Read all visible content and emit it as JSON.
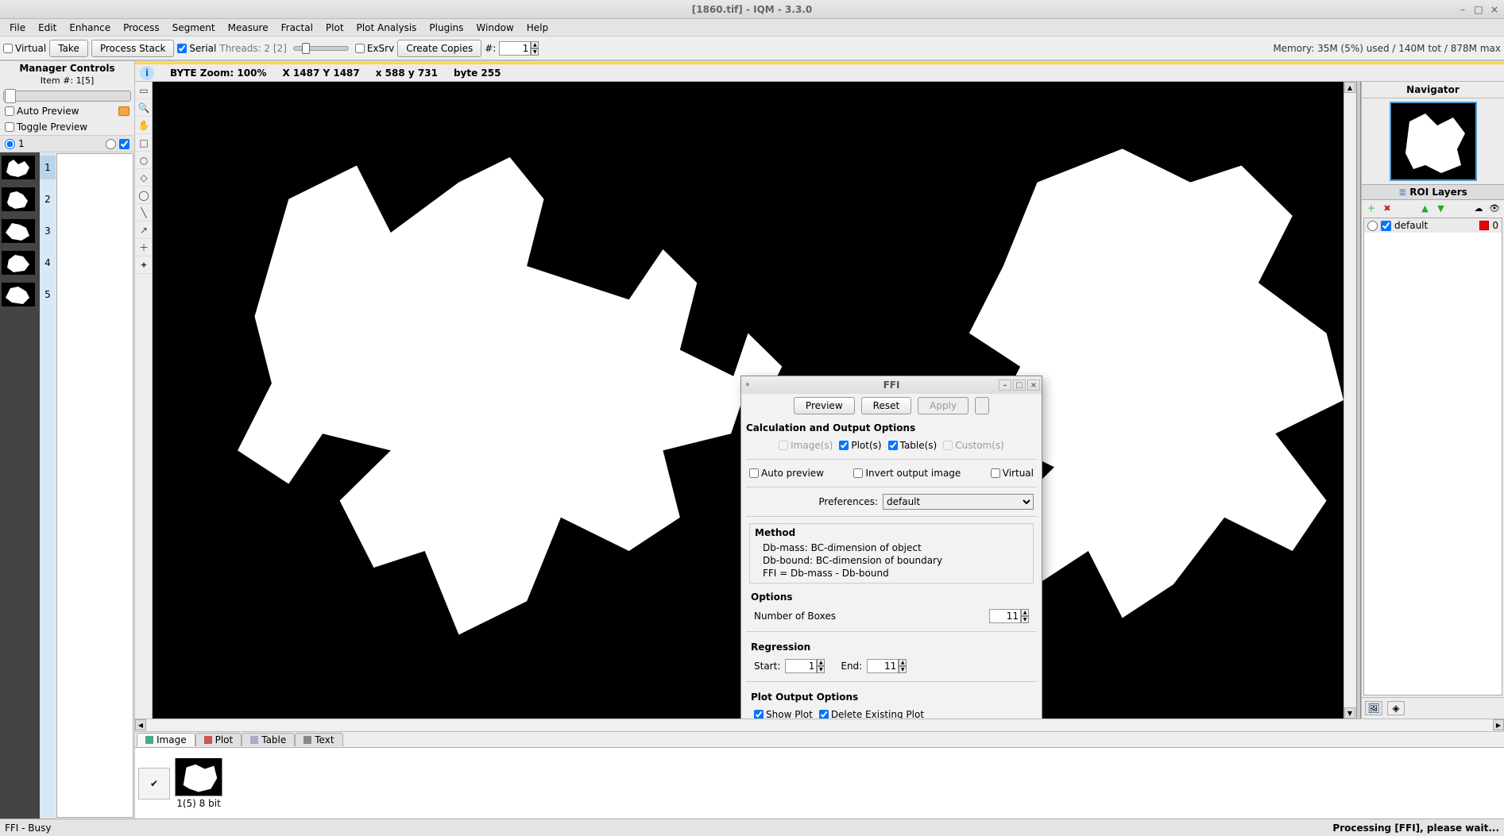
{
  "title": "[1860.tif] - IQM - 3.3.0",
  "window_controls": {
    "min": "–",
    "max": "□",
    "close": "×"
  },
  "menu": [
    "File",
    "Edit",
    "Enhance",
    "Process",
    "Segment",
    "Measure",
    "Fractal",
    "Plot",
    "Plot Analysis",
    "Plugins",
    "Window",
    "Help"
  ],
  "toolbar": {
    "virtual": "Virtual",
    "take": "Take",
    "process_stack": "Process Stack",
    "serial": "Serial",
    "threads": "Threads: 2 [2]",
    "exsrv": "ExSrv",
    "create_copies": "Create Copies",
    "hash_label": "#:",
    "hash_val": "1",
    "memory": "Memory: 35M (5%) used / 140M tot / 878M max"
  },
  "manager": {
    "title": "Manager Controls",
    "item": "Item #: 1[5]",
    "auto_preview": "Auto Preview",
    "toggle_preview": "Toggle Preview",
    "radio_val": "1",
    "thumbs": [
      "1",
      "2",
      "3",
      "4",
      "5"
    ]
  },
  "infobar": {
    "a": "BYTE Zoom: 100%",
    "b": "X 1487  Y 1487",
    "c": "x 588  y 731",
    "d": "byte 255"
  },
  "tools": [
    "▭",
    "🔍",
    "✋",
    "□",
    "○",
    "◇",
    "◯",
    "╲",
    "↗",
    "＋",
    "✦"
  ],
  "navigator": {
    "title": "Navigator"
  },
  "roi": {
    "title": "ROI Layers",
    "row": {
      "name": "default",
      "count": "0"
    }
  },
  "tabs": {
    "image": "Image",
    "plot": "Plot",
    "table": "Table",
    "text": "Text"
  },
  "thumb_label": "1(5) 8 bit",
  "status": {
    "left": "FFI - Busy",
    "right": "Processing [FFI], please wait..."
  },
  "dialog": {
    "title": "FFI",
    "preview": "Preview",
    "reset": "Reset",
    "apply": "Apply",
    "calc_title": "Calculation and Output Options",
    "images": "Image(s)",
    "plots": "Plot(s)",
    "tables": "Table(s)",
    "customs": "Custom(s)",
    "auto_preview": "Auto preview",
    "invert": "Invert output image",
    "virtual": "Virtual",
    "pref_label": "Preferences:",
    "pref_val": "default",
    "method": {
      "title": "Method",
      "l1": "Db-mass:    BC-dimension of object",
      "l2": "Db-bound: BC-dimension of boundary",
      "l3": "FFI = Db-mass - Db-bound"
    },
    "options": {
      "title": "Options",
      "boxes_label": "Number of Boxes",
      "boxes_val": "11"
    },
    "regression": {
      "title": "Regression",
      "start_label": "Start:",
      "start_val": "1",
      "end_label": "End:",
      "end_val": "11"
    },
    "plotout": {
      "title": "Plot Output Options",
      "show": "Show Plot",
      "delete": "Delete Existing Plot"
    }
  }
}
